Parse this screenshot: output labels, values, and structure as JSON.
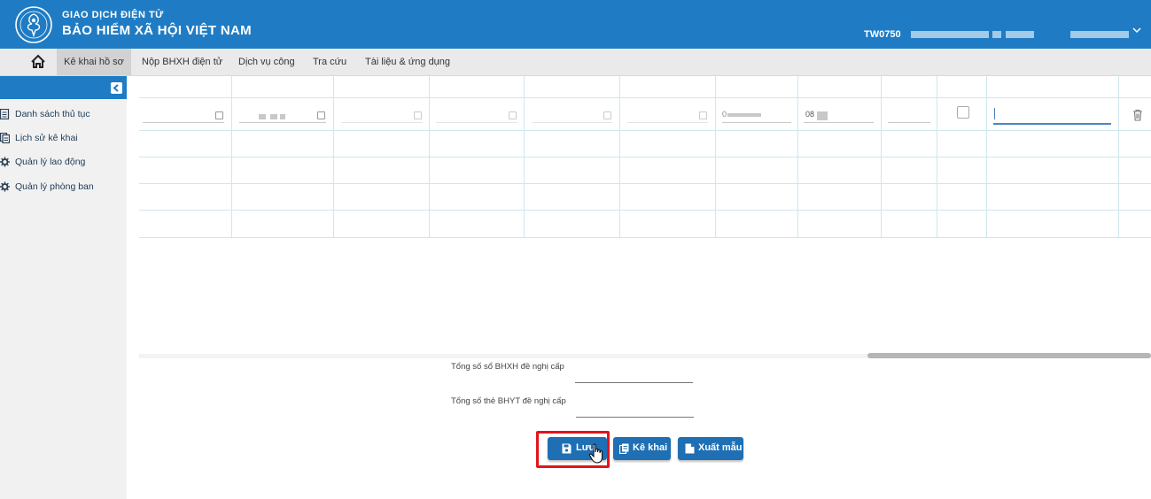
{
  "header": {
    "brand_top": "GIAO DỊCH ĐIỆN TỬ",
    "brand_main": "BẢO HIỂM XÃ HỘI VIỆT NAM",
    "user_code": "TW0750",
    "colors": {
      "primary": "#1f7cc4"
    }
  },
  "nav": {
    "home_icon": "home-icon",
    "items": [
      {
        "label": "Kê khai hồ sơ",
        "active": true
      },
      {
        "label": "Nộp BHXH điện tử",
        "active": false
      },
      {
        "label": "Dịch vụ công",
        "active": false
      },
      {
        "label": "Tra cứu",
        "active": false
      },
      {
        "label": "Tài liệu & ứng dụng",
        "active": false
      }
    ]
  },
  "sidebar": {
    "collapse_icon": "collapse-left-icon",
    "items": [
      {
        "label": "Danh sách thủ tục",
        "icon": "list-icon"
      },
      {
        "label": "Lịch sử kê khai",
        "icon": "history-icon"
      },
      {
        "label": "Quản lý lao động",
        "icon": "gear-icon"
      },
      {
        "label": "Quản lý phòng ban",
        "icon": "gear-icon"
      }
    ]
  },
  "grid": {
    "row1": {
      "partial_text_a": "0",
      "partial_text_b": "08"
    }
  },
  "summary": {
    "bhxh_label": "Tổng số sổ BHXH đề nghị cấp",
    "bhyt_label": "Tổng số thẻ BHYT đề nghị cấp"
  },
  "buttons": {
    "save": "Lưu",
    "declare": "Kê khai",
    "export": "Xuất mẫu"
  }
}
